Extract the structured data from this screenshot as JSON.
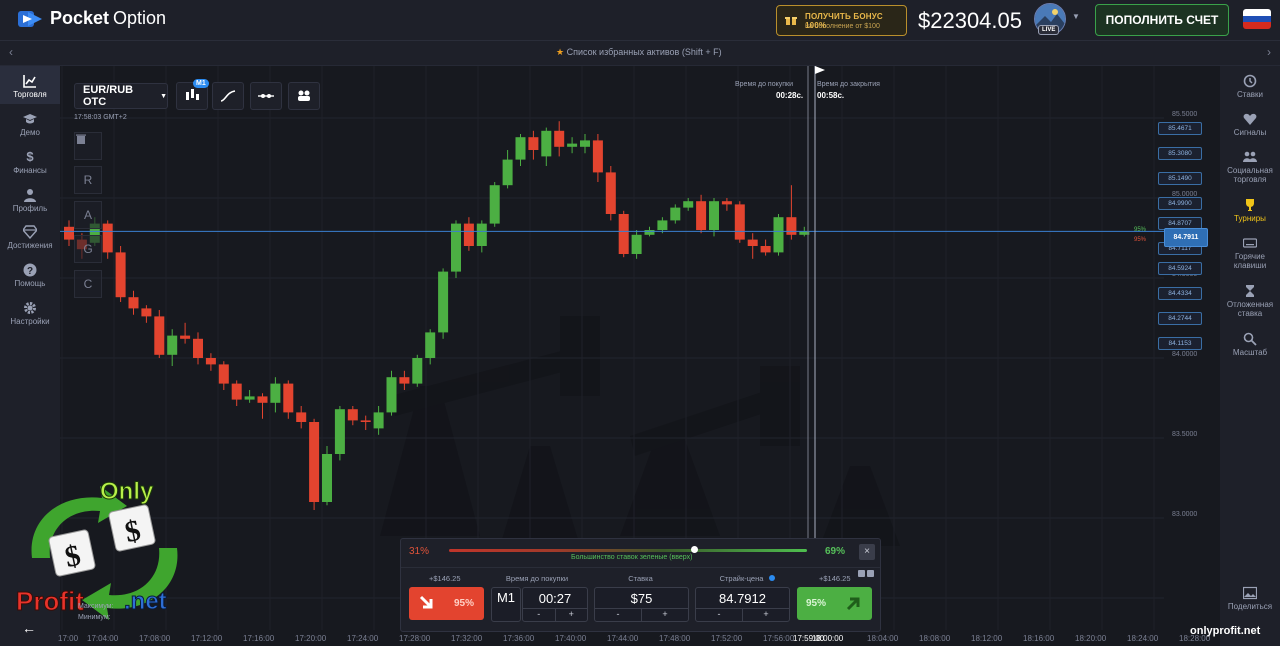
{
  "header": {
    "logo_text_bold": "Pocket",
    "logo_text": "Option",
    "bonus_line1": "ПОЛУЧИТЬ БОНУС 100%",
    "bonus_line2": "на пополнение от $100",
    "balance": "$22304.05",
    "live_badge": "LIVE",
    "deposit_label": "ПОПОЛНИТЬ СЧЕТ"
  },
  "favorites_bar": {
    "text": "Список избранных активов (Shift + F)"
  },
  "left_nav": [
    {
      "label": "Торговля",
      "icon": "chart-icon"
    },
    {
      "label": "Демо",
      "icon": "graduation-cap-icon"
    },
    {
      "label": "Финансы",
      "icon": "dollar-icon"
    },
    {
      "label": "Профиль",
      "icon": "user-icon"
    },
    {
      "label": "Достижения",
      "icon": "diamond-icon"
    },
    {
      "label": "Помощь",
      "icon": "help-icon"
    },
    {
      "label": "Настройки",
      "icon": "gear-icon"
    }
  ],
  "right_nav": [
    {
      "label": "Ставки",
      "icon": "history-icon"
    },
    {
      "label": "Сигналы",
      "icon": "heartbeat-icon"
    },
    {
      "label": "Социальная торговля",
      "icon": "users-icon"
    },
    {
      "label": "Турниры",
      "icon": "trophy-icon"
    },
    {
      "label": "Горячие клавиши",
      "icon": "keyboard-icon"
    },
    {
      "label": "Отложенная ставка",
      "icon": "hourglass-icon"
    },
    {
      "label": "Масштаб",
      "icon": "zoom-icon"
    },
    {
      "label": "Поделиться",
      "icon": "share-image-icon"
    }
  ],
  "chart_toolbar": {
    "pair": "EUR/RUB OTC",
    "timeframe_badge": "M1",
    "server_time": "17:58:03 GMT+2",
    "side_buttons": [
      "R",
      "A",
      "G",
      "C"
    ]
  },
  "timers": {
    "purchase_label": "Время до покупки",
    "purchase_value": "00:28с.",
    "close_label": "Время до закрытия",
    "close_value": "00:58с."
  },
  "price_axis": {
    "labels": [
      "85.5000",
      "85.0000",
      "84.5000",
      "84.0000",
      "83.5000",
      "83.0000"
    ],
    "boxes": [
      "85.4671",
      "85.3080",
      "85.1490",
      "84.9900",
      "84.8707",
      "84.7117",
      "84.5924",
      "84.4334",
      "84.2744",
      "84.1153"
    ],
    "current_price": "84.7911",
    "payout_up": "95%",
    "payout_down": "95%"
  },
  "time_axis": [
    "17:00",
    "17:04:00",
    "17:08:00",
    "17:12:00",
    "17:16:00",
    "17:20:00",
    "17:24:00",
    "17:28:00",
    "17:32:00",
    "17:36:00",
    "17:40:00",
    "17:44:00",
    "17:48:00",
    "17:52:00",
    "17:56:00",
    "17:59:00",
    "18:00:00",
    "18:04:00",
    "18:08:00",
    "18:12:00",
    "18:16:00",
    "18:20:00",
    "18:24:00",
    "18:28:00"
  ],
  "chart_data": {
    "type": "candlestick",
    "title": "",
    "xlabel": "",
    "ylabel": "",
    "ylim": [
      82.9,
      85.55
    ],
    "candles": [
      [
        84.82,
        84.74,
        84.86,
        84.7
      ],
      [
        84.74,
        84.68,
        84.78,
        84.62
      ],
      [
        84.72,
        84.84,
        84.88,
        84.7
      ],
      [
        84.84,
        84.66,
        84.86,
        84.62
      ],
      [
        84.66,
        84.38,
        84.7,
        84.35
      ],
      [
        84.38,
        84.31,
        84.42,
        84.27
      ],
      [
        84.31,
        84.26,
        84.33,
        84.22
      ],
      [
        84.26,
        84.02,
        84.3,
        84.0
      ],
      [
        84.02,
        84.14,
        84.18,
        83.95
      ],
      [
        84.14,
        84.12,
        84.22,
        84.09
      ],
      [
        84.12,
        84.0,
        84.16,
        83.96
      ],
      [
        84.0,
        83.96,
        84.03,
        83.92
      ],
      [
        83.96,
        83.84,
        83.98,
        83.8
      ],
      [
        83.84,
        83.74,
        83.86,
        83.7
      ],
      [
        83.74,
        83.76,
        83.8,
        83.72
      ],
      [
        83.76,
        83.72,
        83.78,
        83.62
      ],
      [
        83.72,
        83.84,
        83.88,
        83.66
      ],
      [
        83.84,
        83.66,
        83.86,
        83.62
      ],
      [
        83.66,
        83.6,
        83.7,
        83.56
      ],
      [
        83.6,
        83.1,
        83.62,
        83.05
      ],
      [
        83.1,
        83.4,
        83.45,
        83.08
      ],
      [
        83.4,
        83.68,
        83.7,
        83.36
      ],
      [
        83.68,
        83.61,
        83.7,
        83.58
      ],
      [
        83.61,
        83.6,
        83.64,
        83.55
      ],
      [
        83.56,
        83.66,
        83.7,
        83.52
      ],
      [
        83.66,
        83.88,
        83.92,
        83.64
      ],
      [
        83.88,
        83.84,
        83.92,
        83.8
      ],
      [
        83.84,
        84.0,
        84.02,
        83.82
      ],
      [
        84.0,
        84.16,
        84.18,
        83.96
      ],
      [
        84.16,
        84.54,
        84.56,
        84.12
      ],
      [
        84.54,
        84.84,
        84.86,
        84.5
      ],
      [
        84.84,
        84.7,
        84.88,
        84.67
      ],
      [
        84.7,
        84.84,
        84.86,
        84.66
      ],
      [
        84.84,
        85.08,
        85.1,
        84.82
      ],
      [
        85.08,
        85.24,
        85.3,
        85.06
      ],
      [
        85.24,
        85.38,
        85.4,
        85.2
      ],
      [
        85.38,
        85.3,
        85.42,
        85.24
      ],
      [
        85.26,
        85.42,
        85.44,
        85.2
      ],
      [
        85.42,
        85.32,
        85.48,
        85.26
      ],
      [
        85.32,
        85.34,
        85.38,
        85.28
      ],
      [
        85.32,
        85.36,
        85.4,
        85.28
      ],
      [
        85.36,
        85.16,
        85.4,
        85.1
      ],
      [
        85.16,
        84.9,
        85.2,
        84.86
      ],
      [
        84.9,
        84.65,
        84.92,
        84.63
      ],
      [
        84.65,
        84.77,
        84.8,
        84.62
      ],
      [
        84.77,
        84.8,
        84.82,
        84.76
      ],
      [
        84.8,
        84.86,
        84.88,
        84.78
      ],
      [
        84.86,
        84.94,
        84.96,
        84.84
      ],
      [
        84.94,
        84.98,
        85.0,
        84.92
      ],
      [
        84.98,
        84.8,
        85.02,
        84.78
      ],
      [
        84.8,
        84.98,
        85.0,
        84.76
      ],
      [
        84.98,
        84.96,
        85.0,
        84.92
      ],
      [
        84.96,
        84.74,
        84.98,
        84.72
      ],
      [
        84.74,
        84.7,
        84.78,
        84.62
      ],
      [
        84.7,
        84.66,
        84.74,
        84.64
      ],
      [
        84.66,
        84.88,
        84.9,
        84.64
      ],
      [
        84.88,
        84.77,
        85.08,
        84.74
      ],
      [
        84.77,
        84.79,
        84.82,
        84.76
      ]
    ],
    "current_price": 84.7911
  },
  "trade_panel": {
    "pct_down": "31%",
    "pct_up": "69%",
    "majority_text": "Большинство ставок зеленые (вверх)",
    "close_label": "×",
    "payout_left": "+$146.25",
    "payout_right": "+$146.25",
    "down_pct": "95%",
    "up_pct": "95%",
    "time_label": "Время до покупки",
    "timeframe": "M1",
    "time_value": "00:27",
    "stake_label": "Ставка",
    "stake_value": "$75",
    "strike_label": "Страйк-цена",
    "strike_value": "84.7912",
    "minus": "-",
    "plus": "+"
  },
  "overlay": {
    "logo_only": "Only",
    "logo_profit": "Profit",
    "logo_net": ".net",
    "hidden_line1": "Максимум:",
    "hidden_line2": "Минимум:",
    "site_watermark": "onlyprofit.net"
  },
  "colors": {
    "up": "#4caf43",
    "down": "#e3442f",
    "accent": "#2f6fb5",
    "bonus": "#e9b84a"
  }
}
